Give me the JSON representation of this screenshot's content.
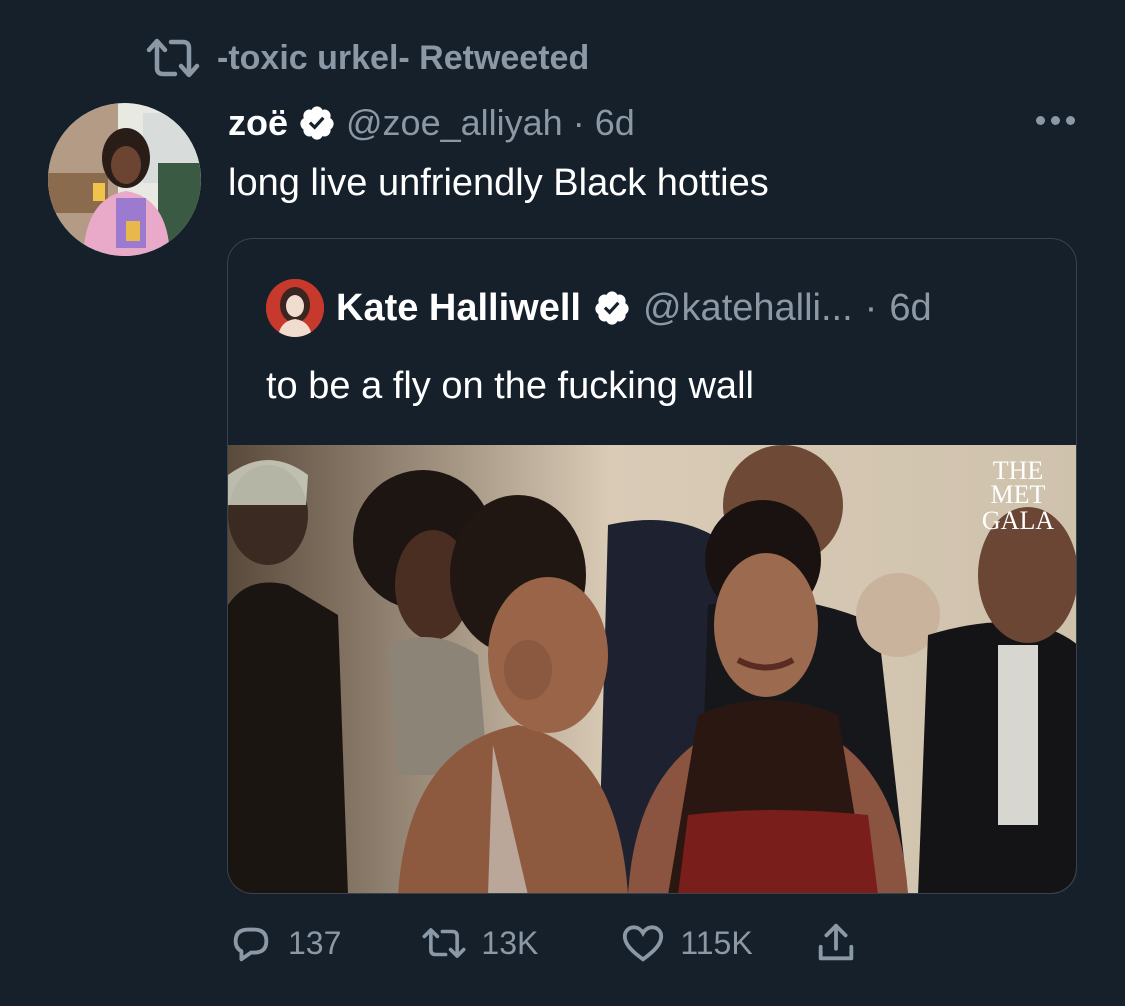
{
  "retweet": {
    "icon": "retweet-icon",
    "label": "-toxic urkel- Retweeted"
  },
  "tweet": {
    "author_name": "zoë",
    "verified": true,
    "handle": "@zoe_alliyah",
    "separator": "·",
    "time": "6d",
    "text": "long live unfriendly Black hotties",
    "more_icon": "more-horizontal-icon"
  },
  "quote": {
    "author_name": "Kate Halliwell",
    "verified": true,
    "handle": "@katehalli...",
    "separator": "·",
    "time": "6d",
    "text": "to be a fly on the fucking wall",
    "media_watermark": [
      "THE",
      "MET",
      "GALA"
    ]
  },
  "actions": {
    "reply_count": "137",
    "retweet_count": "13K",
    "like_count": "115K",
    "icons": [
      "reply-icon",
      "retweet-icon",
      "like-icon",
      "share-icon"
    ]
  },
  "colors": {
    "background": "#15202b",
    "secondary_text": "#8b98a5",
    "border": "#38444d",
    "verified_badge": "#ffffff"
  }
}
